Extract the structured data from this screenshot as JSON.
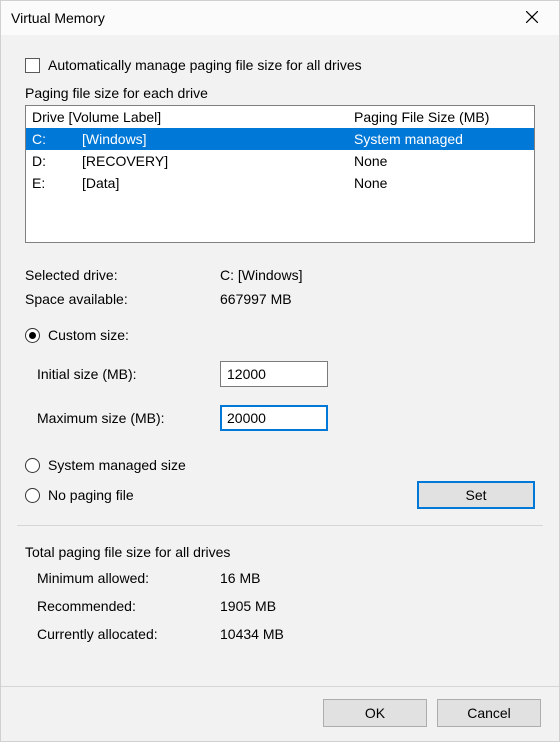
{
  "title": "Virtual Memory",
  "auto_manage": {
    "label": "Automatically manage paging file size for all drives",
    "checked": false
  },
  "list": {
    "heading": "Paging file size for each drive",
    "cols": {
      "drive_label": "Drive  [Volume Label]",
      "size": "Paging File Size (MB)"
    },
    "rows": [
      {
        "drive": "C:",
        "label": "[Windows]",
        "size": "System managed",
        "selected": true
      },
      {
        "drive": "D:",
        "label": "[RECOVERY]",
        "size": "None",
        "selected": false
      },
      {
        "drive": "E:",
        "label": "[Data]",
        "size": "None",
        "selected": false
      }
    ]
  },
  "selected": {
    "drive_label": "Selected drive:",
    "drive_value": "C:  [Windows]",
    "space_label": "Space available:",
    "space_value": "667997 MB"
  },
  "options": {
    "custom": {
      "label": "Custom size:",
      "checked": true
    },
    "system": {
      "label": "System managed size",
      "checked": false
    },
    "none": {
      "label": "No paging file",
      "checked": false
    }
  },
  "custom": {
    "initial_label": "Initial size (MB):",
    "initial_value": "12000",
    "max_label": "Maximum size (MB):",
    "max_value": "20000"
  },
  "set_label": "Set",
  "totals": {
    "heading": "Total paging file size for all drives",
    "min_label": "Minimum allowed:",
    "min_value": "16 MB",
    "rec_label": "Recommended:",
    "rec_value": "1905 MB",
    "cur_label": "Currently allocated:",
    "cur_value": "10434 MB"
  },
  "buttons": {
    "ok": "OK",
    "cancel": "Cancel"
  }
}
